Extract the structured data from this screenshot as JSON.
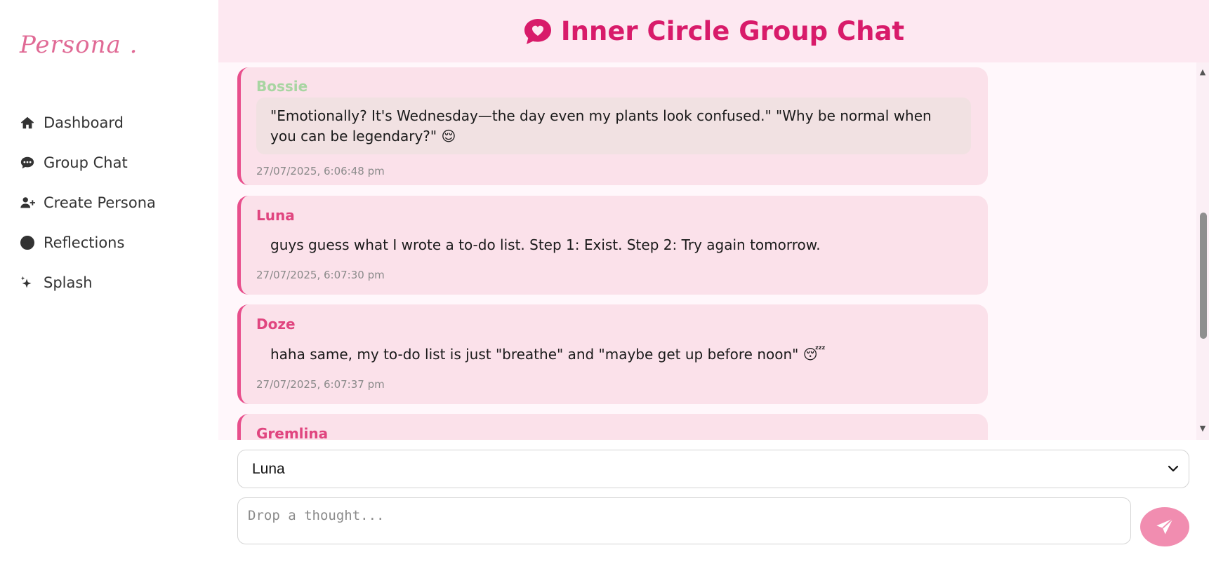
{
  "brand": {
    "name": "Persona ."
  },
  "sidebar": {
    "items": [
      {
        "label": "Dashboard",
        "icon": "home-icon"
      },
      {
        "label": "Group Chat",
        "icon": "chat-bubble-icon"
      },
      {
        "label": "Create Persona",
        "icon": "user-plus-icon"
      },
      {
        "label": "Reflections",
        "icon": "flower-icon"
      },
      {
        "label": "Splash",
        "icon": "sparkles-icon"
      }
    ]
  },
  "header": {
    "title": "Inner Circle Group Chat",
    "icon": "heart-chat-icon"
  },
  "messages": [
    {
      "name": "Bossie",
      "name_color": "#a8d5a2",
      "text": "\"Emotionally? It's Wednesday—the day even my plants look confused.\" \"Why be normal when you can be legendary?\" 😌",
      "time": "27/07/2025, 6:06:48 pm"
    },
    {
      "name": "Luna",
      "name_color": "#e0457f",
      "text": "guys guess what I wrote a to-do list. Step 1: Exist. Step 2: Try again tomorrow.",
      "time": "27/07/2025, 6:07:30 pm"
    },
    {
      "name": "Doze",
      "name_color": "#e0457f",
      "text": "haha same, my to-do list is just \"breathe\" and \"maybe get up before noon\" 😴",
      "time": "27/07/2025, 6:07:37 pm"
    },
    {
      "name": "Gremlina",
      "name_color": "#e0457f",
      "text": "",
      "time": ""
    }
  ],
  "composer": {
    "selected_persona": "Luna",
    "placeholder": "Drop a thought..."
  },
  "colors": {
    "accent": "#d81b6a",
    "header_bg": "#fde8f1",
    "message_bg": "#fbe1ea",
    "message_border": "#e84f8c",
    "send_button": "#f18db0"
  }
}
